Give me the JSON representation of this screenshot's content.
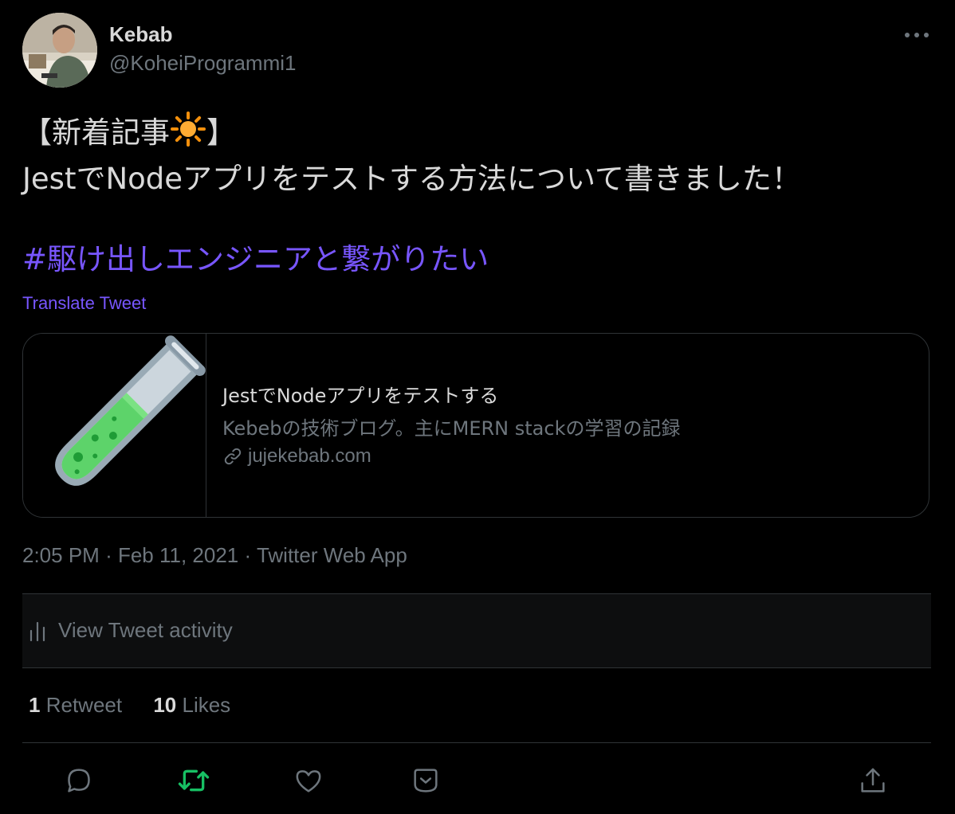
{
  "author": {
    "display_name": "Kebab",
    "handle": "@KoheiProgrammi1"
  },
  "tweet": {
    "line1_prefix": "【新着記事",
    "line1_suffix": "】",
    "line2": "JestでNodeアプリをテストする方法について書きました！",
    "hashtag": "#駆け出しエンジニアと繋がりたい",
    "translate_label": "Translate Tweet"
  },
  "card": {
    "title": "JestでNodeアプリをテストする",
    "description": "Kebebの技術ブログ。主にMERN stackの学習の記録",
    "domain": "jujekebab.com",
    "image_icon": "test-tube-icon"
  },
  "meta": {
    "time": "2:05 PM",
    "separator": "·",
    "date": "Feb 11, 2021",
    "source": "Twitter Web App"
  },
  "activity": {
    "label": "View Tweet activity"
  },
  "stats": {
    "retweets_count": "1",
    "retweets_label": "Retweet",
    "likes_count": "10",
    "likes_label": "Likes"
  },
  "colors": {
    "background": "#000000",
    "text": "#d9d9d9",
    "secondary": "#6e767d",
    "accent": "#7856ff",
    "retweet_active": "#17bf63",
    "border": "#2f3336"
  },
  "icons": [
    "more-icon",
    "sun-emoji-icon",
    "link-icon",
    "bar-chart-icon",
    "reply-icon",
    "retweet-icon",
    "like-icon",
    "bookmark-icon",
    "share-icon"
  ]
}
